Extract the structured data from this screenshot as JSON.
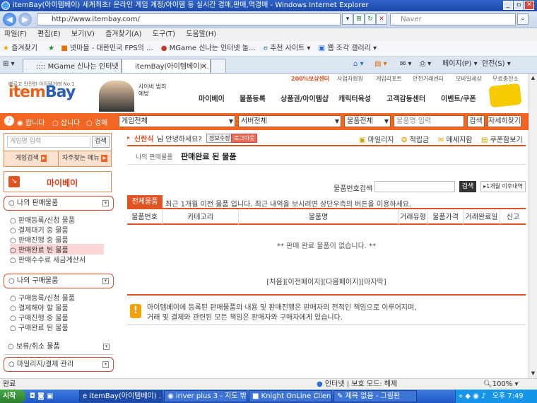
{
  "window": {
    "title": "itemBay(아이템베이) 세계최초! 온라인 게임 계정/아이템 등 실시간 경매,판매,역경매 - Windows Internet Explorer"
  },
  "browser": {
    "url": "http://www.itembay.com/",
    "search_placeholder": "Naver"
  },
  "menu": [
    "파일(F)",
    "편집(E)",
    "보기(V)",
    "즐겨찾기(A)",
    "도구(T)",
    "도움말(H)"
  ],
  "favorites": {
    "label": "즐겨찾기",
    "items": [
      "넷마블 - 대한민국 FPS의 ...",
      "MGame 신나는 인터넷 놀...",
      "추천 사이트 ▾",
      "웹 조각 갤러리 ▾"
    ]
  },
  "tabs": [
    ":::: MGame 신나는 인터넷 ...",
    "itemBay(아이템베이) ..."
  ],
  "commandbar": {
    "page": "페이지(P) ▾",
    "safety": "안전(S) ▾"
  },
  "site": {
    "topnav": [
      "200%보상센터",
      "사업자회원",
      "게임리포트",
      "안전거래센터",
      "모바일세상",
      "무료충전소"
    ],
    "logo_small": "빠르고 안전한 아이템거래 No.1",
    "logo_main": "item",
    "logo_bay": "Bay",
    "promo": "사이버 범죄예방",
    "nav": [
      "마이베이",
      "물품등록",
      "상품권/아이템샵",
      "캐릭터육성",
      "고객감동센터",
      "이벤트/쿠폰"
    ],
    "radios": [
      "팝니다",
      "삽니다",
      "경매"
    ],
    "selects": [
      "게임전체",
      "서버전체",
      "물품전체"
    ],
    "search_input": "물품명 입력",
    "search_btn": "검색",
    "detail_btn": "자세히찾기",
    "left_search_placeholder": "게임명 입력",
    "left_search_btn": "검색",
    "left_tabs": [
      "게임검색",
      "자주찾는 메뉴"
    ],
    "mybay": "마이베이",
    "sections": [
      {
        "title": "나의 판매물품",
        "items": [
          "판매등록/신청 물품",
          "결제대기 중 물품",
          "판매진행 중 물품",
          "판매완료 된 물품",
          "판매수수료 세금계산서"
        ]
      },
      {
        "title": "나의 구매물품",
        "items": [
          "구매등록/신청 물품",
          "결제해야 할 물품",
          "구매진행 중 물품",
          "구매완료 된 물품"
        ]
      },
      {
        "title": "보류/취소 물품",
        "items": []
      },
      {
        "title": "마일리지/결제 관리",
        "items": []
      }
    ],
    "greeting_name": "신란식",
    "greeting_text": "님 안녕하세요?",
    "badge1": "정보수정",
    "badge2": "로그아웃",
    "quick_links": [
      "마일리지",
      "적립금",
      "메세지함",
      "쿠폰함보기"
    ],
    "breadcrumb": "나의 판매물품",
    "page_title": "판매완료 된 물품",
    "search_label": "물품번호검색",
    "search_go": "검색",
    "search_period": "▸1개월 이후내역",
    "tab_all": "전체물품",
    "tab_desc": "최근 1개월 이전 물품 입니다. 최근 내역을 보시려면 상단우측의 버튼을 이용하세요.",
    "columns": [
      "물품번호",
      "카테고리",
      "물품명",
      "거래유형",
      "물품가격",
      "거래완료일",
      "신고"
    ],
    "empty_text": "** 판매 완료 물품이 없습니다. **",
    "pager": "[처음][이전페이지][다음페이지][마지막]",
    "notice_line1": "아이템베이에 등록된 판매물품의 내용 및 판매진행은 판매자의 전적인 책임으로 이루어지며,",
    "notice_line2": "거래 및 결제와 관련된 모든 책임은 판매자와 구매자에게 있습니다."
  },
  "status": {
    "left": "완료",
    "zone": "인터넷 | 보호 모드: 해제",
    "zoom": "100%"
  },
  "taskbar": {
    "start": "시작",
    "tasks": [
      "itemBay(아이템베이) ...",
      "iriver plus 3 - 지도 밖...",
      "Knight OnLine Client",
      "제목 없음 - 그림판"
    ],
    "clock": "오후 7:49"
  }
}
